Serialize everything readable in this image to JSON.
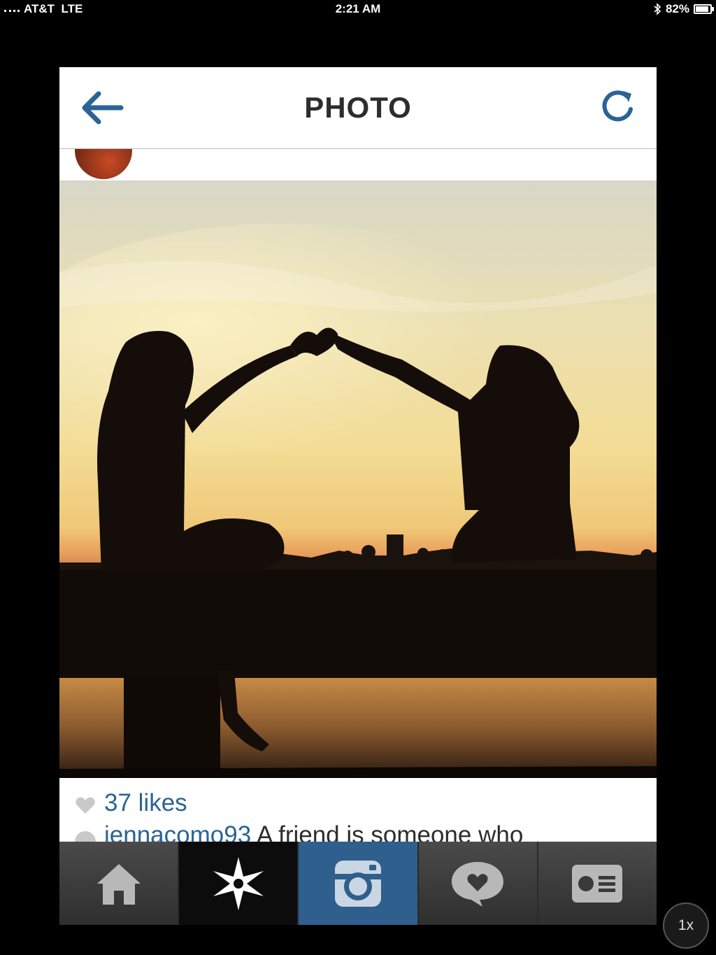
{
  "status_bar": {
    "carrier": "AT&T",
    "network": "LTE",
    "time": "2:21 AM",
    "battery_percent": "82%",
    "icons": [
      "signal-icon",
      "bluetooth-icon",
      "battery-icon"
    ]
  },
  "header": {
    "title": "PHOTO",
    "back_icon": "arrow-left-icon",
    "refresh_icon": "refresh-icon",
    "accent": "#2a6496"
  },
  "post": {
    "likes": "37 likes",
    "caption_user": "jennacomo93",
    "caption_text": "A friend is someone who"
  },
  "tabbar": {
    "items": [
      {
        "icon": "home-icon",
        "active": false
      },
      {
        "icon": "explore-star-icon",
        "active": false
      },
      {
        "icon": "camera-icon",
        "active": true
      },
      {
        "icon": "news-heart-icon",
        "active": false
      },
      {
        "icon": "profile-card-icon",
        "active": false
      }
    ],
    "active_color": "#2f5f8c"
  },
  "zoom": {
    "label": "1x"
  }
}
